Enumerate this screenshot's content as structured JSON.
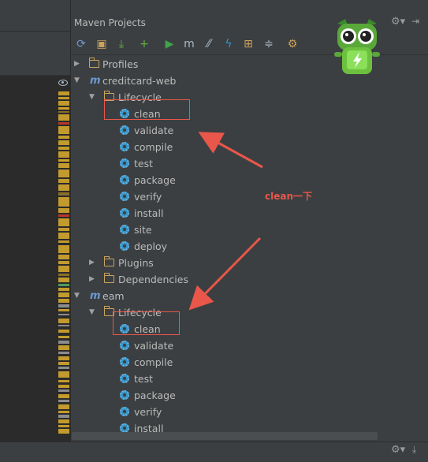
{
  "panel": {
    "title": "Maven Projects",
    "header_icons": [
      "gear-icon",
      "pin-icon"
    ]
  },
  "editor": {
    "close_glyph": "✕"
  },
  "toolbar": {
    "buttons": [
      {
        "name": "reimport-button",
        "glyph": "⟳",
        "color": "#6b9ad3"
      },
      {
        "name": "generate-sources-button",
        "glyph": "▣",
        "color": "#c9a25e"
      },
      {
        "name": "download-button",
        "glyph": "⤓",
        "color": "#62b543"
      },
      {
        "name": "add-project-button",
        "glyph": "+",
        "color": "#62b543"
      },
      {
        "name": "run-build-button",
        "glyph": "▶",
        "color": "#3fa34d"
      },
      {
        "name": "execute-goal-button",
        "glyph": "m",
        "color": "#a9b7c6"
      },
      {
        "name": "toggle-offline-button",
        "glyph": "⁄⁄",
        "color": "#a9b7c6"
      },
      {
        "name": "skip-tests-button",
        "glyph": "ϟ",
        "color": "#3592c4"
      },
      {
        "name": "dependencies-diagram-button",
        "glyph": "⊞",
        "color": "#c9a25e"
      },
      {
        "name": "collapse-all-button",
        "glyph": "≑",
        "color": "#a9b7c6"
      },
      {
        "name": "settings-button",
        "glyph": "⚙",
        "color": "#c9a25e"
      }
    ]
  },
  "tree": {
    "profiles": "Profiles",
    "project1": {
      "name": "creditcard-web",
      "lifecycle": "Lifecycle",
      "goals": [
        "clean",
        "validate",
        "compile",
        "test",
        "package",
        "verify",
        "install",
        "site",
        "deploy"
      ],
      "plugins": "Plugins",
      "dependencies": "Dependencies"
    },
    "project2": {
      "name": "eam",
      "lifecycle": "Lifecycle",
      "goals": [
        "clean",
        "validate",
        "compile",
        "test",
        "package",
        "verify",
        "install"
      ]
    }
  },
  "annotation": {
    "note": "clean一下",
    "color": "#e8574a"
  },
  "footer_icons": [
    "gear-icon",
    "download-icon"
  ]
}
